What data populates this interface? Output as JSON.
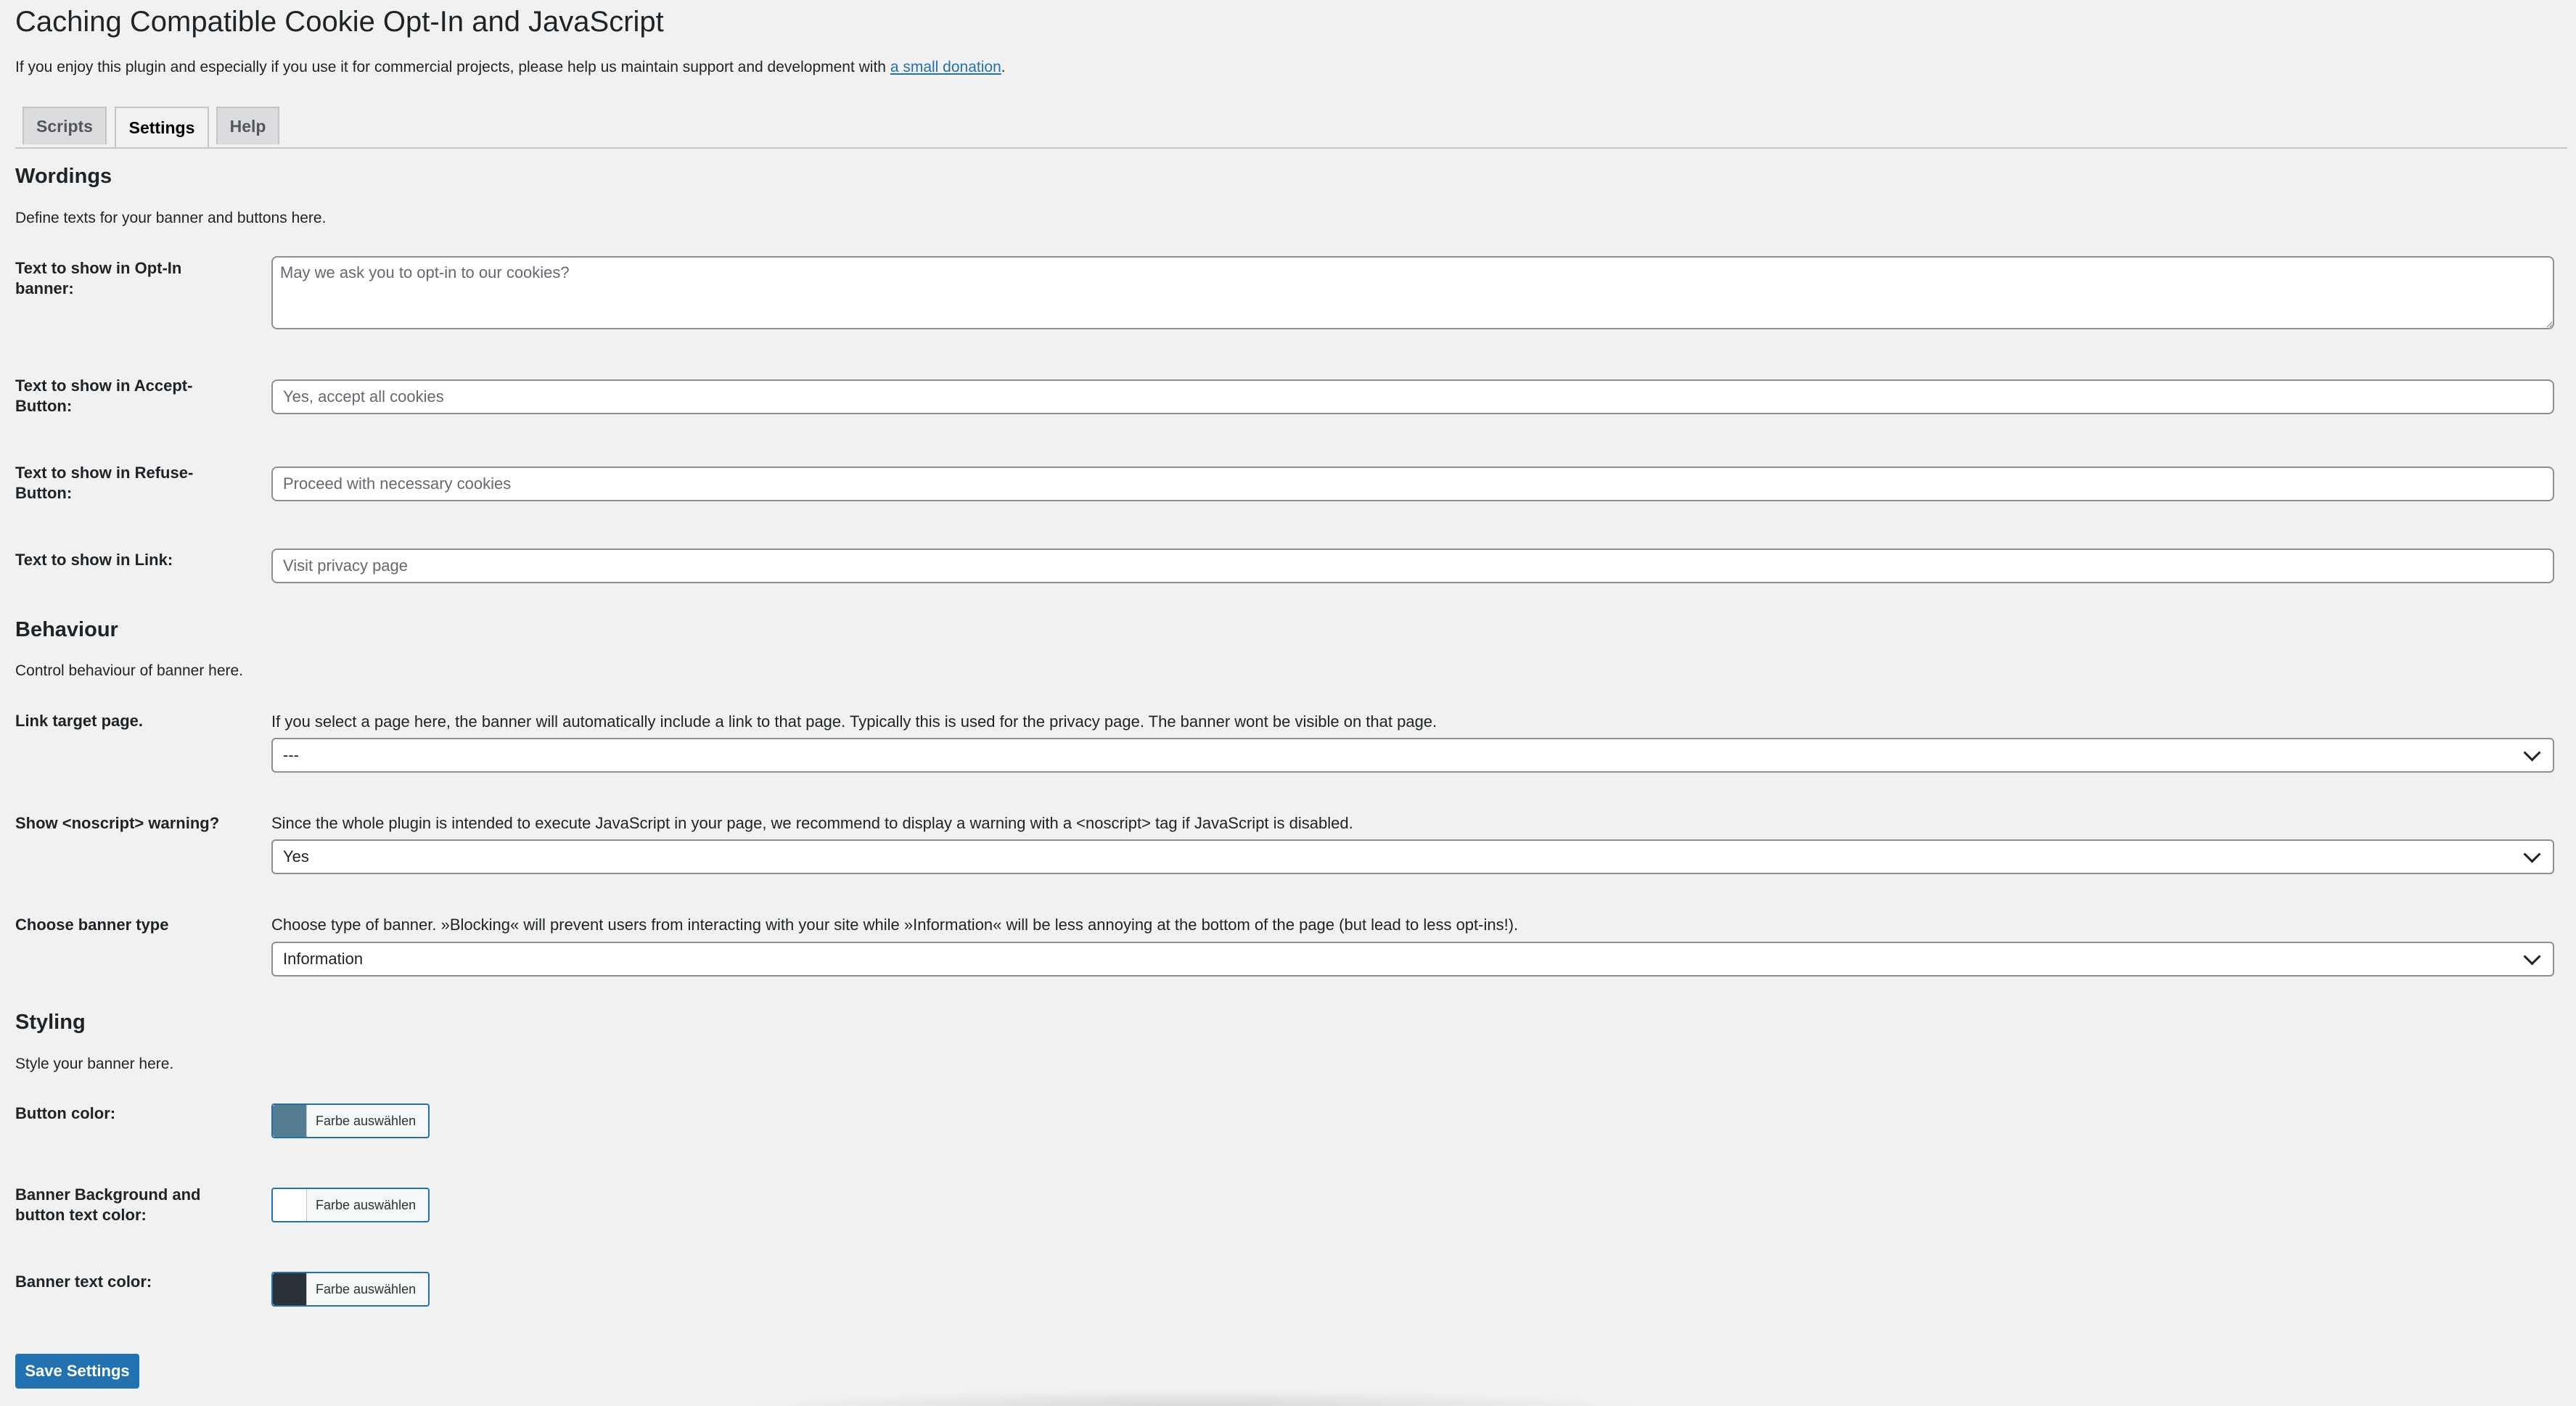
{
  "page": {
    "title": "Caching Compatible Cookie Opt-In and JavaScript",
    "intro_text": "If you enjoy this plugin and especially if you use it for commercial projects, please help us maintain support and development with ",
    "intro_link": "a small donation",
    "intro_end": "."
  },
  "tabs": [
    {
      "label": "Scripts"
    },
    {
      "label": "Settings"
    },
    {
      "label": "Help"
    }
  ],
  "wordings": {
    "heading": "Wordings",
    "desc": "Define texts for your banner and buttons here.",
    "optin_label": "Text to show in Opt-In banner:",
    "optin_placeholder": "May we ask you to opt-in to our cookies?",
    "accept_label": "Text to show in Accept-Button:",
    "accept_placeholder": "Yes, accept all cookies",
    "refuse_label": "Text to show in Refuse-Button:",
    "refuse_placeholder": "Proceed with necessary cookies",
    "link_label": "Text to show in Link:",
    "link_placeholder": "Visit privacy page"
  },
  "behaviour": {
    "heading": "Behaviour",
    "desc": "Control behaviour of banner here.",
    "target_label": "Link target page.",
    "target_help": "If you select a page here, the banner will automatically include a link to that page. Typically this is used for the privacy page. The banner wont be visible on that page.",
    "target_value": "---",
    "noscript_label": "Show <noscript> warning?",
    "noscript_help": "Since the whole plugin is intended to execute JavaScript in your page, we recommend to display a warning with a <noscript> tag if JavaScript is disabled.",
    "noscript_value": "Yes",
    "type_label": "Choose banner type",
    "type_help": "Choose type of banner. »Blocking« will prevent users from interacting with your site while »Information« will be less annoying at the bottom of the page (but lead to less opt-ins!).",
    "type_value": "Information"
  },
  "styling": {
    "heading": "Styling",
    "desc": "Style your banner here.",
    "button_color_label": "Button color:",
    "bg_color_label": "Banner Background and button text color:",
    "text_color_label": "Banner text color:",
    "color_button_text": "Farbe auswählen",
    "colors": {
      "button": "#567c92",
      "background": "#ffffff",
      "text": "#2c3338"
    }
  },
  "actions": {
    "save_label": "Save Settings"
  }
}
